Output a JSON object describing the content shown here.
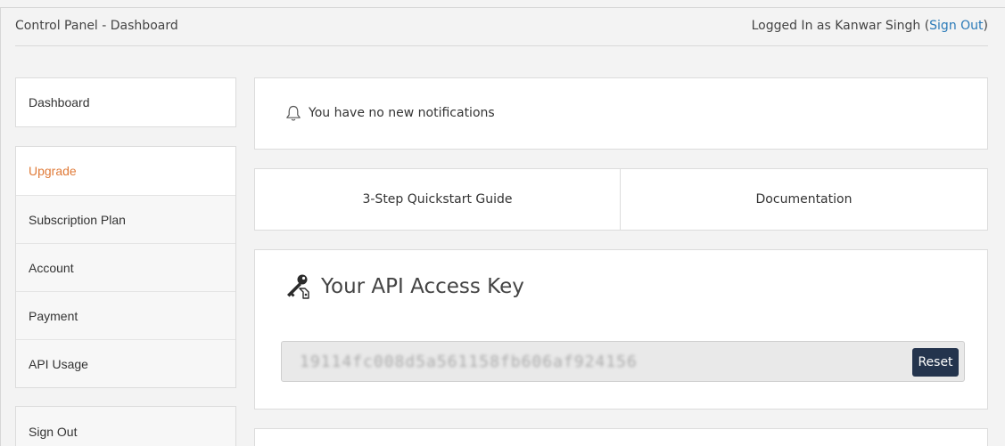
{
  "header": {
    "title": "Control Panel - Dashboard",
    "user_prefix": "Logged In as Kanwar Singh (",
    "sign_out_link": "Sign Out",
    "user_suffix": ")"
  },
  "sidebar": {
    "dashboard": "Dashboard",
    "items": [
      {
        "label": "Upgrade"
      },
      {
        "label": "Subscription Plan"
      },
      {
        "label": "Account"
      },
      {
        "label": "Payment"
      },
      {
        "label": "API Usage"
      }
    ],
    "sign_out": "Sign Out"
  },
  "notifications": {
    "icon": "bell-icon",
    "text": "You have no new notifications"
  },
  "guides": {
    "quickstart": "3-Step Quickstart Guide",
    "documentation": "Documentation"
  },
  "api_key": {
    "icon": "keys-icon",
    "title": "Your API Access Key",
    "value": "19114fc008d5a561158fb606af924156",
    "reset_label": "Reset"
  },
  "colors": {
    "accent": "#e07b39",
    "link": "#2a7ab8",
    "button": "#24344d"
  }
}
